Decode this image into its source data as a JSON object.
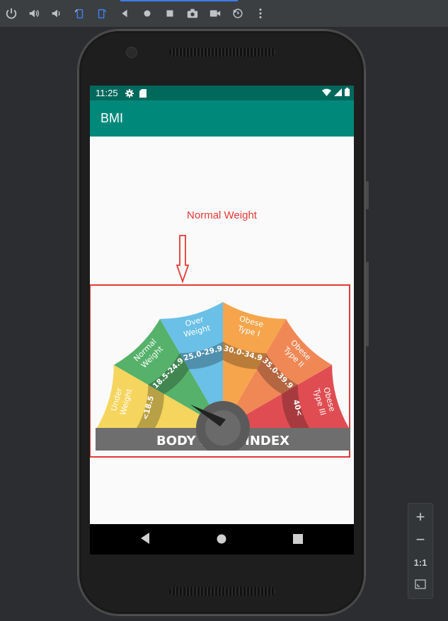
{
  "toolbar": {
    "icons": [
      "power-icon",
      "volume-up-icon",
      "volume-down-icon",
      "rotate-left-icon",
      "rotate-right-icon",
      "back-icon",
      "home-icon",
      "overview-icon",
      "camera-icon",
      "video-icon",
      "snapshot-icon",
      "more-icon"
    ]
  },
  "status_bar": {
    "time": "11:25"
  },
  "app_bar": {
    "title": "BMI"
  },
  "result": {
    "label": "Normal Weight"
  },
  "gauge": {
    "title": "BODY MASS INDEX",
    "segments": [
      {
        "name_line1": "Under",
        "name_line2": "Weight",
        "range": "<18.5",
        "color": "#f5d55d"
      },
      {
        "name_line1": "Normal",
        "name_line2": "Weight",
        "range": "18.5-24.9",
        "color": "#56b16a"
      },
      {
        "name_line1": "Over",
        "name_line2": "Weight",
        "range": "25.0-29.9",
        "color": "#6ac0e6"
      },
      {
        "name_line1": "Obese",
        "name_line2": "Type I",
        "range": "30.0-34.9",
        "color": "#f6a54c"
      },
      {
        "name_line1": "Obese",
        "name_line2": "Type II",
        "range": "35.0-39.9",
        "color": "#f08856"
      },
      {
        "name_line1": "Obese",
        "name_line2": "Type III",
        "range": "40<",
        "color": "#df4d52"
      }
    ]
  },
  "zoom": {
    "plus": "+",
    "minus": "−",
    "one_to_one": "1:1"
  },
  "colors": {
    "accent": "#00897b",
    "status": "#00695c",
    "result": "#e53935"
  }
}
